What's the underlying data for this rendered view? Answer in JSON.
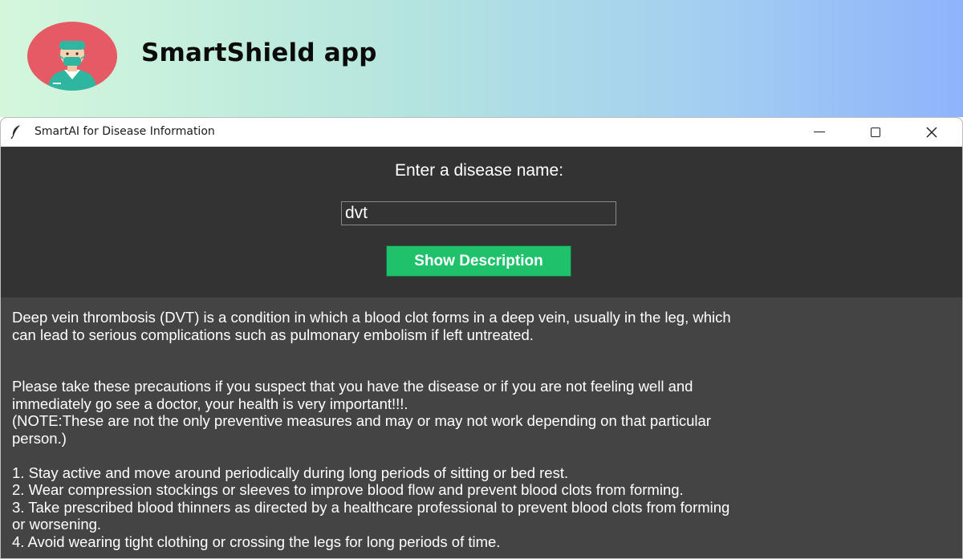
{
  "banner": {
    "app_title": "SmartShield app",
    "avatar_icon": "doctor-avatar-icon",
    "gradient_colors": [
      "#d4f7dc",
      "#8fb3fb"
    ]
  },
  "window": {
    "title": "SmartAI for Disease Information",
    "app_icon": "feather-icon",
    "controls": [
      "minimize-icon",
      "maximize-icon",
      "close-icon"
    ]
  },
  "form": {
    "prompt": "Enter a disease name:",
    "input_value": "dvt",
    "button_label": "Show Description",
    "button_color": "#1fc16a"
  },
  "description": {
    "text": "Deep vein thrombosis (DVT) is a condition in which a blood clot forms in a deep vein, usually in the leg, which\ncan lead to serious complications such as pulmonary embolism if left untreated.\n\n\nPlease take these precautions if you suspect that you have the disease or if you are not feeling well and\nimmediately go see a doctor, your health is very important!!!.\n(NOTE:These are not the only preventive measures and may or may not work depending on that particular\nperson.)\n\n1. Stay active and move around periodically during long periods of sitting or bed rest.\n2. Wear compression stockings or sleeves to improve blood flow and prevent blood clots from forming.\n3. Take prescribed blood thinners as directed by a healthcare professional to prevent blood clots from forming\nor worsening.\n4. Avoid wearing tight clothing or crossing the legs for long periods of time."
  }
}
